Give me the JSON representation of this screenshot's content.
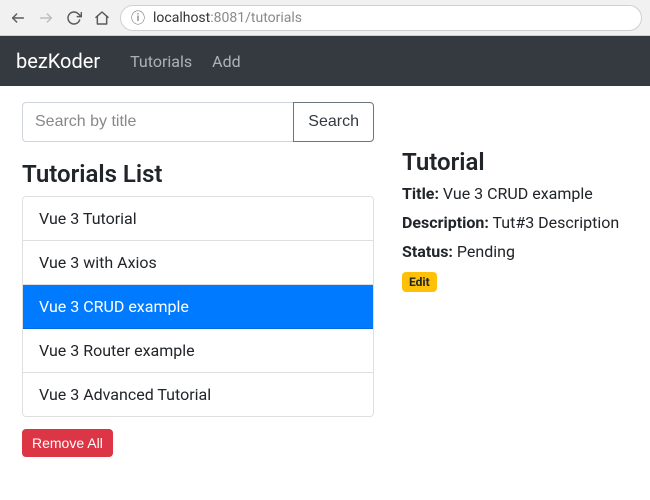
{
  "browser": {
    "url_host": "localhost",
    "url_port": ":8081",
    "url_path": "/tutorials"
  },
  "nav": {
    "brand": "bezKoder",
    "links": [
      "Tutorials",
      "Add"
    ]
  },
  "search": {
    "placeholder": "Search by title",
    "value": "",
    "button": "Search"
  },
  "list": {
    "heading": "Tutorials List",
    "items": [
      "Vue 3 Tutorial",
      "Vue 3 with Axios",
      "Vue 3 CRUD example",
      "Vue 3 Router example",
      "Vue 3 Advanced Tutorial"
    ],
    "active_index": 2,
    "remove_all": "Remove All"
  },
  "detail": {
    "heading": "Tutorial",
    "title_label": "Title:",
    "title_value": "Vue 3 CRUD example",
    "description_label": "Description:",
    "description_value": "Tut#3 Description",
    "status_label": "Status:",
    "status_value": "Pending",
    "edit": "Edit"
  }
}
